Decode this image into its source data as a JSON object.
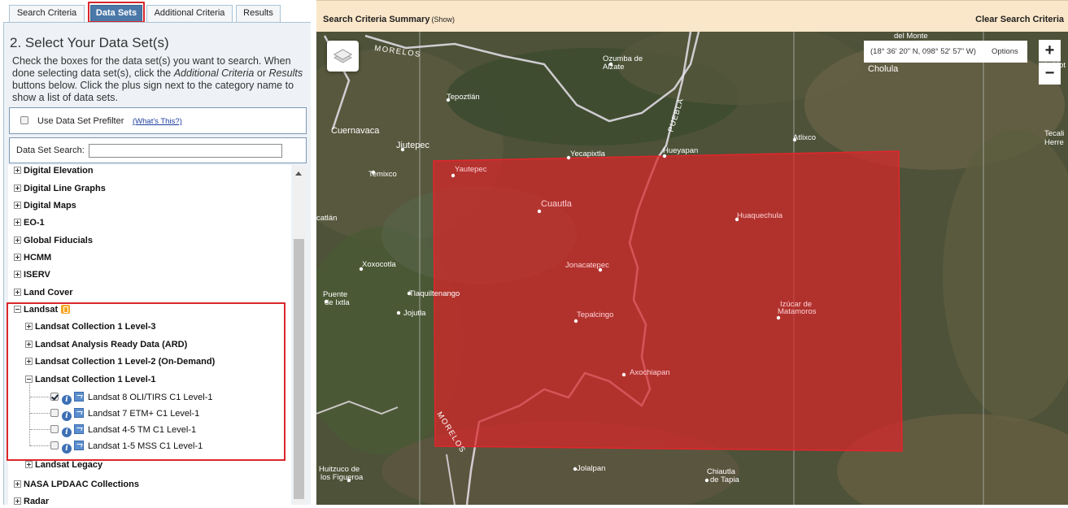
{
  "tabs": [
    {
      "label": "Search Criteria",
      "active": false
    },
    {
      "label": "Data Sets",
      "active": true
    },
    {
      "label": "Additional Criteria",
      "active": false
    },
    {
      "label": "Results",
      "active": false
    }
  ],
  "panel": {
    "title": "2. Select Your Data Set(s)",
    "instructions_1": "Check the boxes for the data set(s) you want to search. When done selecting data set(s), click the ",
    "instructions_em1": "Additional Criteria",
    "instructions_2": " or ",
    "instructions_em2": "Results",
    "instructions_3": " buttons below. Click the plus sign next to the category name to show a list of data sets.",
    "prefilter_label": "Use Data Set Prefilter",
    "whats_this": "(What's This?)",
    "search_label": "Data Set Search:",
    "search_value": ""
  },
  "tree": {
    "digital_elevation": "Digital Elevation",
    "digital_line_graphs": "Digital Line Graphs",
    "digital_maps": "Digital Maps",
    "eo1": "EO-1",
    "global_fiducials": "Global Fiducials",
    "hcmm": "HCMM",
    "iserv": "ISERV",
    "land_cover": "Land Cover",
    "landsat": "Landsat",
    "l_c1_level3": "Landsat Collection 1 Level-3",
    "l_ard": "Landsat Analysis Ready Data (ARD)",
    "l_c1_level2": "Landsat Collection 1 Level-2 (On-Demand)",
    "l_c1_level1": "Landsat Collection 1 Level-1",
    "leaf_l8": "Landsat 8 OLI/TIRS C1 Level-1",
    "leaf_l7": "Landsat 7 ETM+ C1 Level-1",
    "leaf_l45tm": "Landsat 4-5 TM C1 Level-1",
    "leaf_l15mss": "Landsat 1-5 MSS C1 Level-1",
    "l_legacy": "Landsat Legacy",
    "nasa_lpdaac": "NASA LPDAAC Collections",
    "radar": "Radar"
  },
  "map": {
    "summary_title": "Search Criteria Summary",
    "summary_show": "(Show)",
    "clear_search": "Clear Search Criteria",
    "coords": "(18° 36' 20\" N, 098° 52' 57\" W)",
    "options": "Options",
    "zoom_in": "+",
    "zoom_out": "−",
    "labels": {
      "morelos_top": "MORELOS",
      "ozumba": "Ozumba de",
      "alzate": "Alzate",
      "del_monte": "del Monte",
      "de_motz": "de Mot",
      "cholula": "Cholula",
      "tepoztlan": "Tepoztlán",
      "puebla": "PUEBLA",
      "cuernavaca": "Cuernavaca",
      "jiutepec": "Jiutepec",
      "yecapixtla": "Yecapixtla",
      "hueyapan": "Hueyapan",
      "atlixco": "Atlixco",
      "tecali": "Tecali",
      "herrera": "Herre",
      "temixco": "Temixco",
      "yautepec": "Yautepec",
      "cuautla": "Cuautla",
      "huaquechula": "Huaquechula",
      "catlan": "catlán",
      "xoxocotla": "Xoxocotla",
      "jonacatepec": "Jonacatepec",
      "puente": "Puente",
      "de_ixtla": "de Ixtla",
      "tlaquiltenango": "Tlaquiltenango",
      "jojutla": "Jojutla",
      "tepalcingo": "Tepalcingo",
      "izucar": "Izúcar de",
      "matamoros": "Matamoros",
      "axochiapan": "Axochiapan",
      "morelos_bottom": "MORELOS",
      "huitzuco": "Huitzuco de",
      "los_figueroa": "los Figueroa",
      "jolalpan": "Jolalpan",
      "chiautla": "Chiautla",
      "de_tapia": "de Tapia"
    }
  }
}
